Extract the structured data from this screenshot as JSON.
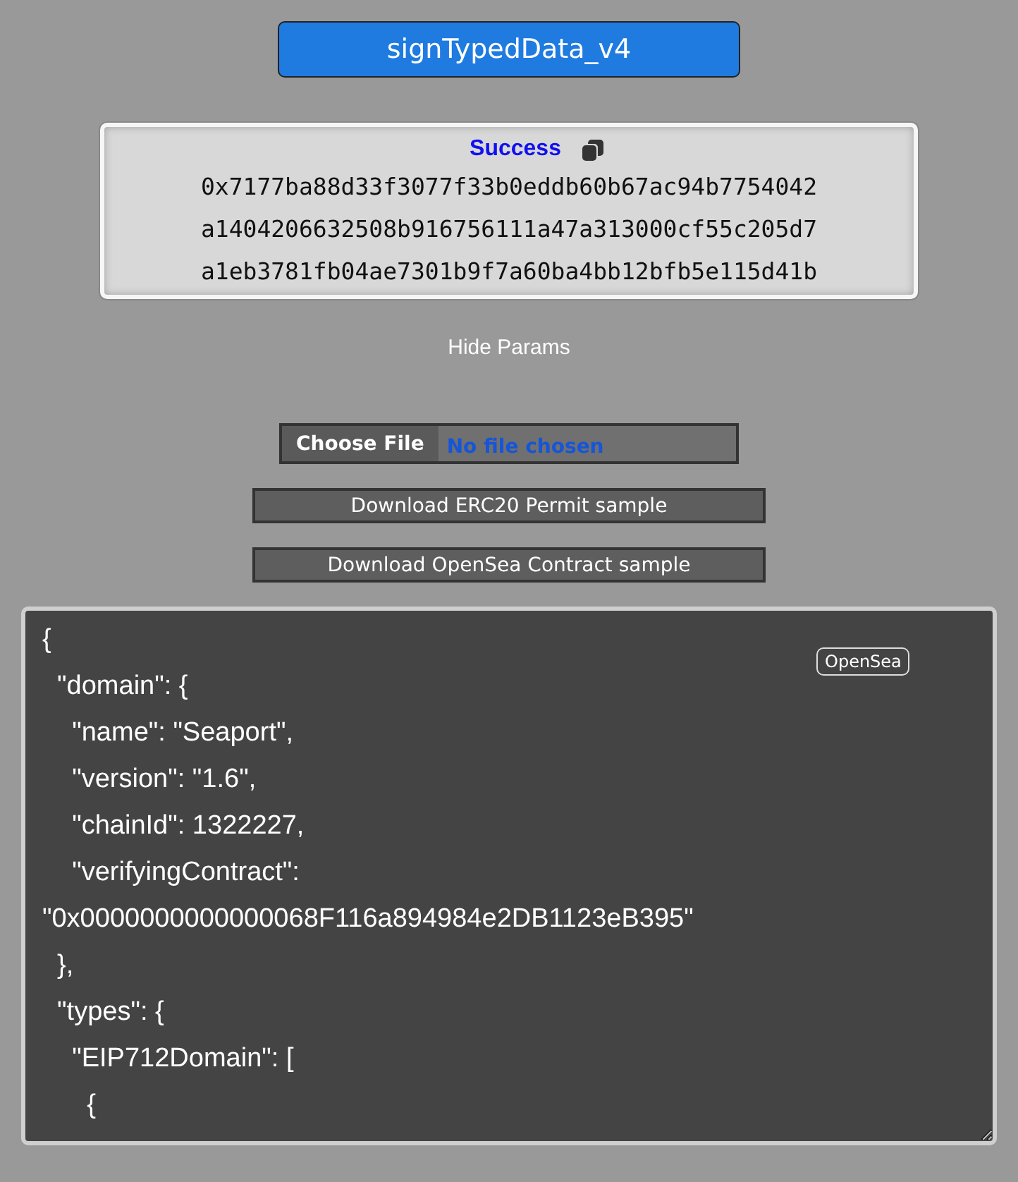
{
  "method_button": "signTypedData_v4",
  "result": {
    "status": "Success",
    "value_lines": [
      "0x7177ba88d33f3077f33b0eddb60b67ac94b7754042",
      "a1404206632508b916756111a47a313000cf55c205d7",
      "a1eb3781fb04ae7301b9f7a60ba4bb12bfb5e115d41b"
    ]
  },
  "params_toggle": "Hide Params",
  "file_input": {
    "button": "Choose File",
    "status": "No file chosen"
  },
  "sample_buttons": [
    "Download ERC20 Permit sample",
    "Download OpenSea Contract sample"
  ],
  "editor": {
    "badge": "OpenSea",
    "lines": [
      "{",
      "  \"domain\": {",
      "    \"name\": \"Seaport\",",
      "    \"version\": \"1.6\",",
      "    \"chainId\": 1322227,",
      "    \"verifyingContract\":",
      "\"0x0000000000000068F116a894984e2DB1123eB395\"",
      "  },",
      "  \"types\": {",
      "    \"EIP712Domain\": [",
      "      {"
    ]
  }
}
